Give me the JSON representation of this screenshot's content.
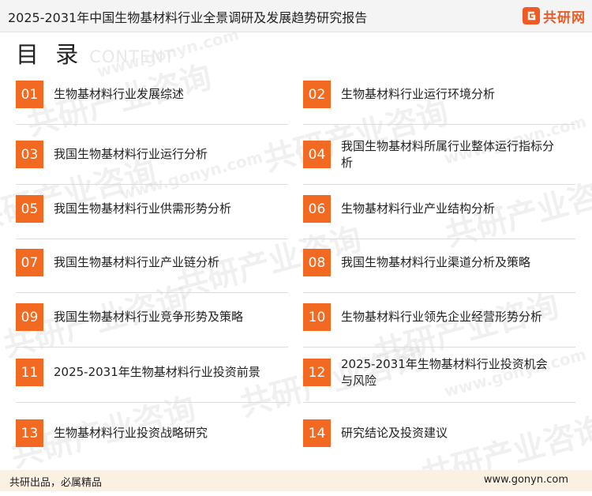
{
  "header": {
    "title": "2025-2031年中国生物基材料行业全景调研及发展趋势研究报告",
    "brand": "共研网"
  },
  "heading": {
    "main": "目 录",
    "sub": "CONTENT"
  },
  "watermarks": {
    "text": "共研产业咨询",
    "url": "www.gonyn.com"
  },
  "toc": [
    {
      "num": "01",
      "text": "生物基材料行业发展综述"
    },
    {
      "num": "02",
      "text": "生物基材料行业运行环境分析"
    },
    {
      "num": "03",
      "text": "我国生物基材料行业运行分析"
    },
    {
      "num": "04",
      "text": "我国生物基材料所属行业整体运行指标分析"
    },
    {
      "num": "05",
      "text": "我国生物基材料行业供需形势分析"
    },
    {
      "num": "06",
      "text": "生物基材料行业产业结构分析"
    },
    {
      "num": "07",
      "text": "我国生物基材料行业产业链分析"
    },
    {
      "num": "08",
      "text": "我国生物基材料行业渠道分析及策略"
    },
    {
      "num": "09",
      "text": "我国生物基材料行业竞争形势及策略"
    },
    {
      "num": "10",
      "text": "生物基材料行业领先企业经营形势分析"
    },
    {
      "num": "11",
      "text": "2025-2031年生物基材料行业投资前景"
    },
    {
      "num": "12",
      "text": "2025-2031年生物基材料行业投资机会与风险"
    },
    {
      "num": "13",
      "text": "生物基材料行业投资战略研究"
    },
    {
      "num": "14",
      "text": "研究结论及投资建议"
    }
  ],
  "footer": {
    "slogan": "共研出品，必属精品",
    "site": "www.gonyn.com"
  },
  "colors": {
    "accent": "#f26a22",
    "brand": "#f05a24",
    "footer_bg": "#faf1e3"
  }
}
